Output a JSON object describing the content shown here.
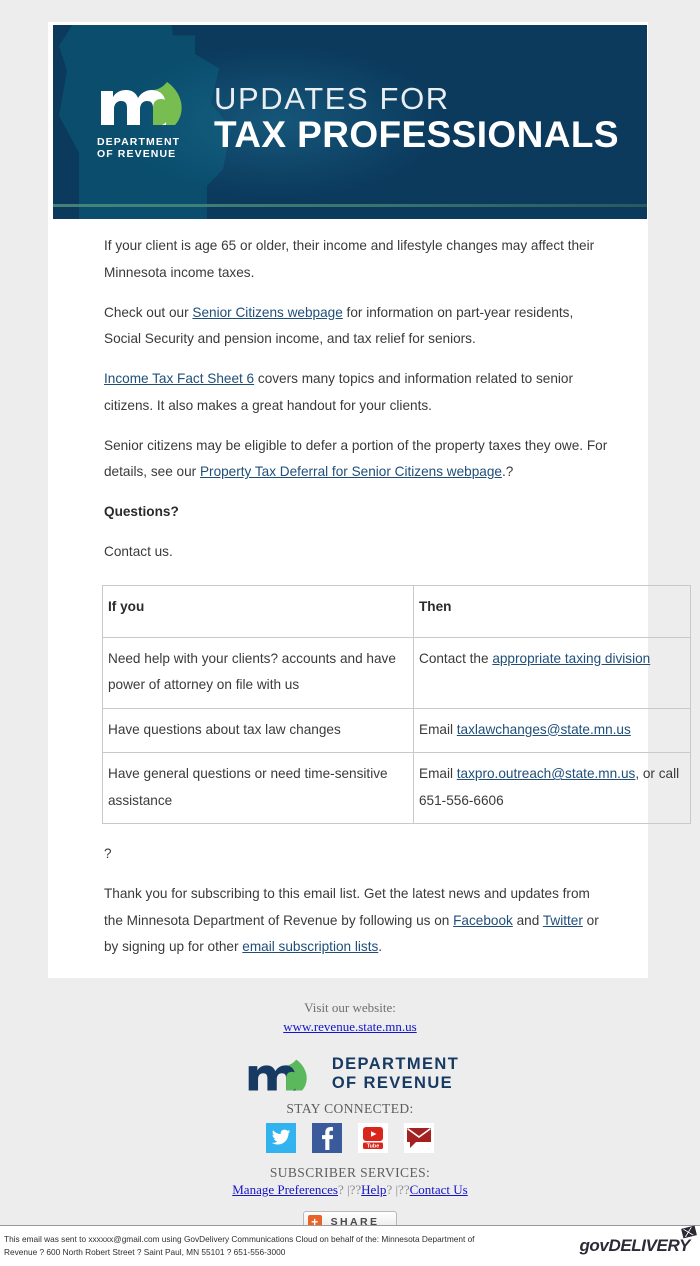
{
  "banner": {
    "logo_dept_line1": "DEPARTMENT",
    "logo_dept_line2": "OF REVENUE",
    "title_line1": "UPDATES FOR",
    "title_line2": "TAX PROFESSIONALS",
    "bg_color": "#0b3a5d",
    "accent_color": "#4e8f7e"
  },
  "body": {
    "p1": "If your client is age 65 or older, their income and lifestyle changes may affect their Minnesota income taxes.",
    "p2_before": "Check out our ",
    "p2_link": "Senior Citizens webpage",
    "p2_after": " for information on part-year residents, Social Security and pension income, and tax relief for seniors.",
    "p3_link": "Income Tax Fact Sheet 6",
    "p3_after": " covers many topics and information related to senior citizens. It also makes a great handout for your clients.",
    "p4_before": "Senior citizens may be eligible to defer a portion of the property taxes they owe. For details, see our ",
    "p4_link": "Property Tax Deferral for Senior Citizens webpage",
    "p4_after": ".?",
    "questions_heading": "Questions?",
    "contact_us": "Contact us.",
    "qmark_after_table": "?",
    "p5_before": "Thank you for subscribing to this email list. Get the latest news and updates from the Minnesota Department of Revenue by following us on ",
    "p5_link1": "Facebook",
    "p5_mid": " and ",
    "p5_link2": "Twitter",
    "p5_mid2": " or by signing up for other ",
    "p5_link3": "email subscription lists",
    "p5_after": ".",
    "qmark_end": "?"
  },
  "table": {
    "headers": [
      "If you",
      "Then"
    ],
    "rows": [
      {
        "if_you": "Need help with your clients? accounts and have power of attorney on file with us",
        "then_before": "Contact the ",
        "then_link": "appropriate taxing division",
        "then_after": ""
      },
      {
        "if_you": "Have questions about tax law changes",
        "then_before": "Email ",
        "then_link": "taxlawchanges@state.mn.us",
        "then_after": ""
      },
      {
        "if_you": "Have general questions or need time-sensitive assistance",
        "then_before": "Email ",
        "then_link": "taxpro.outreach@state.mn.us",
        "then_after": ", or call 651-556-6606"
      }
    ]
  },
  "footer": {
    "visit_label": "Visit our website:",
    "visit_url": "www.revenue.state.mn.us",
    "logo_dept_line1": "DEPARTMENT",
    "logo_dept_line2": "OF REVENUE",
    "stay_connected": "STAY CONNECTED:",
    "social": [
      {
        "name": "twitter",
        "glyph": "ᴠ",
        "color": "#31b3ef"
      },
      {
        "name": "facebook",
        "glyph": "f",
        "color": "#3a5a9b"
      },
      {
        "name": "youtube",
        "glyph": "▶",
        "color": "#d9261c"
      },
      {
        "name": "email",
        "glyph": "✉",
        "color": "#a52020"
      }
    ],
    "subscriber_services": "SUBSCRIBER SERVICES:",
    "link_manage": "Manage Preferences",
    "sep1": "? |??",
    "link_help": "Help",
    "sep2": "? |??",
    "link_contact": "Contact Us",
    "share_label": "SHARE",
    "share_plus": "+"
  },
  "bottom": {
    "line1": "This email was sent to xxxxxx@gmail.com using GovDelivery Communications Cloud on behalf of the: Minnesota Department of",
    "line2": "Revenue ? 600 North Robert Street ? Saint Paul, MN 55101 ? 651-556-3000",
    "brand": "govDELIVERY"
  }
}
